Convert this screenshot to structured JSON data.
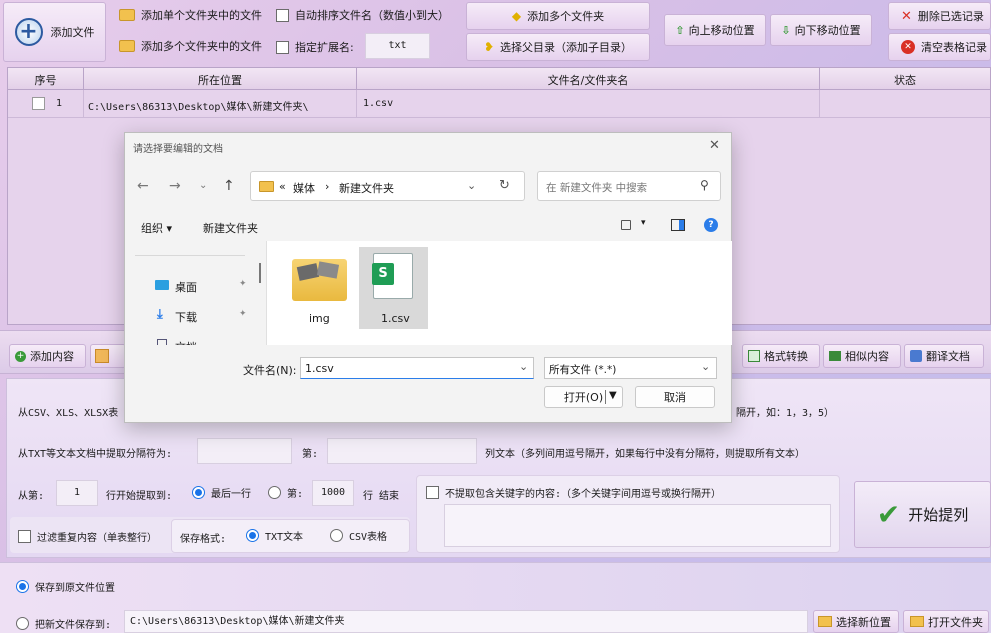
{
  "toolbar": {
    "add_file": "添加文件",
    "add_single_folder": "添加单个文件夹中的文件",
    "add_multi_folder_files": "添加多个文件夹中的文件",
    "auto_sort": "自动排序文件名（数值小到大）",
    "specify_ext": "指定扩展名:",
    "ext_value": "txt",
    "add_multi_folder": "添加多个文件夹",
    "select_parent": "选择父目录（添加子目录）",
    "move_up": "向上移动位置",
    "move_down": "向下移动位置",
    "delete_selected": "删除已选记录",
    "clear_table": "清空表格记录"
  },
  "table": {
    "columns": [
      "序号",
      "所在位置",
      "文件名/文件夹名",
      "状态"
    ],
    "rows": [
      {
        "index": "1",
        "location": "C:\\Users\\86313\\Desktop\\媒体\\新建文件夹\\",
        "name": "1.csv",
        "status": ""
      }
    ]
  },
  "tabs": {
    "add_content": "添加内容",
    "format_convert": "格式转换",
    "similar_content": "相似内容",
    "translate_doc": "翻译文档"
  },
  "options": {
    "line1_prefix": "从CSV、XLS、XLSX表",
    "line1_suffix": "隔开，如：1，3，5）",
    "line2_label": "从TXT等文本文档中提取分隔符为:",
    "line2_di": "第:",
    "line2_suffix": "列文本（多列间用逗号隔开，如果每行中没有分隔符，则提取所有文本）",
    "from_label": "从第:",
    "from_value": "1",
    "start_extract": "行开始提取到:",
    "last_row": "最后一行",
    "di": "第:",
    "to_value": "1000",
    "row_end": "行 结束",
    "exclude_keywords": "不提取包含关键字的内容:（多个关键字间用逗号或换行隔开）",
    "filter_dup": "过滤重复内容（单表整行）",
    "save_format": "保存格式:",
    "fmt_txt": "TXT文本",
    "fmt_csv": "CSV表格",
    "start": "开始提列"
  },
  "save": {
    "save_orig": "保存到原文件位置",
    "save_to": "把新文件保存到:",
    "path": "C:\\Users\\86313\\Desktop\\媒体\\新建文件夹",
    "select_new": "选择新位置",
    "open_folder": "打开文件夹"
  },
  "dialog": {
    "title": "请选择要编辑的文档",
    "breadcrumb": [
      "«",
      "媒体",
      "›",
      "新建文件夹"
    ],
    "search_placeholder": "在 新建文件夹 中搜索",
    "organize": "组织 ▾",
    "new_folder": "新建文件夹",
    "nav": [
      "桌面",
      "下载",
      "文档"
    ],
    "files": [
      {
        "name": "img",
        "type": "folder"
      },
      {
        "name": "1.csv",
        "type": "csv"
      }
    ],
    "filename_label": "文件名(N):",
    "filename_value": "1.csv",
    "filter_value": "所有文件 (*.*)",
    "open": "打开(O)",
    "cancel": "取消"
  }
}
